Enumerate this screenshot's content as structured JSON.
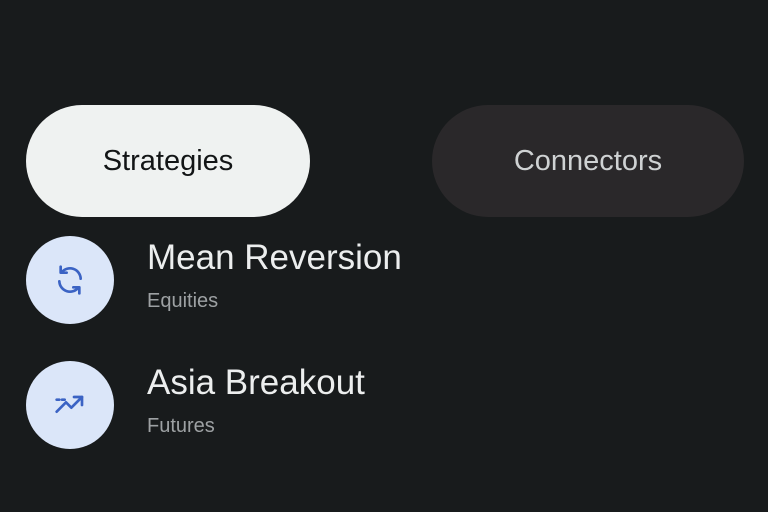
{
  "tabs": [
    {
      "label": "Strategies",
      "selected": true
    },
    {
      "label": "Connectors",
      "selected": false
    }
  ],
  "strategies": [
    {
      "title": "Mean Reversion",
      "subtitle": "Equities",
      "icon": "refresh-icon"
    },
    {
      "title": "Asia Breakout",
      "subtitle": "Futures",
      "icon": "trending-up-icon"
    }
  ],
  "colors": {
    "background": "#181b1c",
    "tab_selected_bg": "#eff2f1",
    "tab_unselected_bg": "#2a282a",
    "icon_bg": "#dbe6f9",
    "icon_fg": "#3b63c4"
  }
}
